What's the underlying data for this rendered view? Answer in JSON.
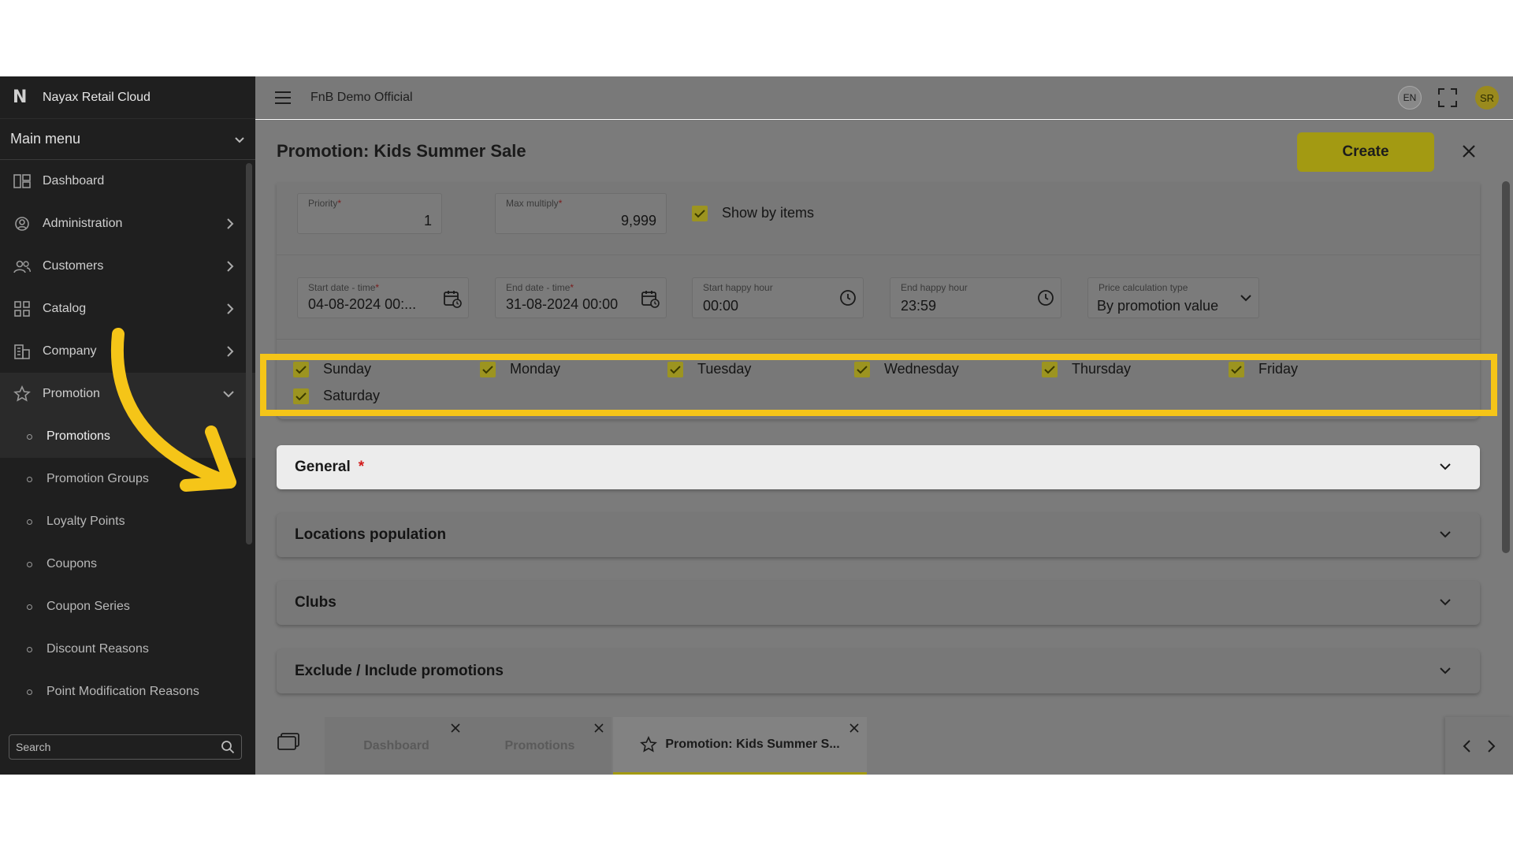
{
  "app": {
    "brand": "Nayax Retail Cloud",
    "company": "FnB Demo Official",
    "lang": "EN",
    "user_initials": "SR"
  },
  "sidebar": {
    "main_menu_label": "Main menu",
    "items": [
      {
        "label": "Dashboard",
        "icon": "dashboard-icon"
      },
      {
        "label": "Administration",
        "icon": "gear-user-icon"
      },
      {
        "label": "Customers",
        "icon": "users-icon"
      },
      {
        "label": "Catalog",
        "icon": "grid-icon"
      },
      {
        "label": "Company",
        "icon": "building-icon"
      },
      {
        "label": "Promotion",
        "icon": "star-icon"
      }
    ],
    "sub_items": [
      "Promotions",
      "Promotion Groups",
      "Loyalty Points",
      "Coupons",
      "Coupon Series",
      "Discount Reasons",
      "Point Modification Reasons"
    ],
    "search_placeholder": "Search"
  },
  "page": {
    "title": "Promotion: Kids Summer Sale",
    "create_label": "Create",
    "fields": {
      "priority": {
        "label": "Priority",
        "value": "1"
      },
      "max_multiply": {
        "label": "Max multiply",
        "value": "9,999"
      },
      "show_by_items": "Show by items",
      "start_date": {
        "label": "Start date - time",
        "value": "04-08-2024 00:..."
      },
      "end_date": {
        "label": "End date - time",
        "value": "31-08-2024 00:00"
      },
      "start_happy_hour": {
        "label": "Start happy hour",
        "value": "00:00"
      },
      "end_happy_hour": {
        "label": "End happy hour",
        "value": "23:59"
      },
      "price_calc": {
        "label": "Price calculation type",
        "value": "By promotion value"
      }
    },
    "days": [
      "Sunday",
      "Monday",
      "Tuesday",
      "Wednesday",
      "Thursday",
      "Friday",
      "Saturday"
    ],
    "sections": {
      "general": "General",
      "required_mark": "*",
      "locations": "Locations population",
      "clubs": "Clubs",
      "exclude_include": "Exclude / Include promotions"
    }
  },
  "tabs": [
    {
      "label": "Dashboard"
    },
    {
      "label": "Promotions"
    },
    {
      "label": "Promotion: Kids Summer S..."
    }
  ],
  "colors": {
    "accent": "#f5c518",
    "create_button": "#a39a12",
    "sidebar_bg": "#1f1f1f"
  }
}
